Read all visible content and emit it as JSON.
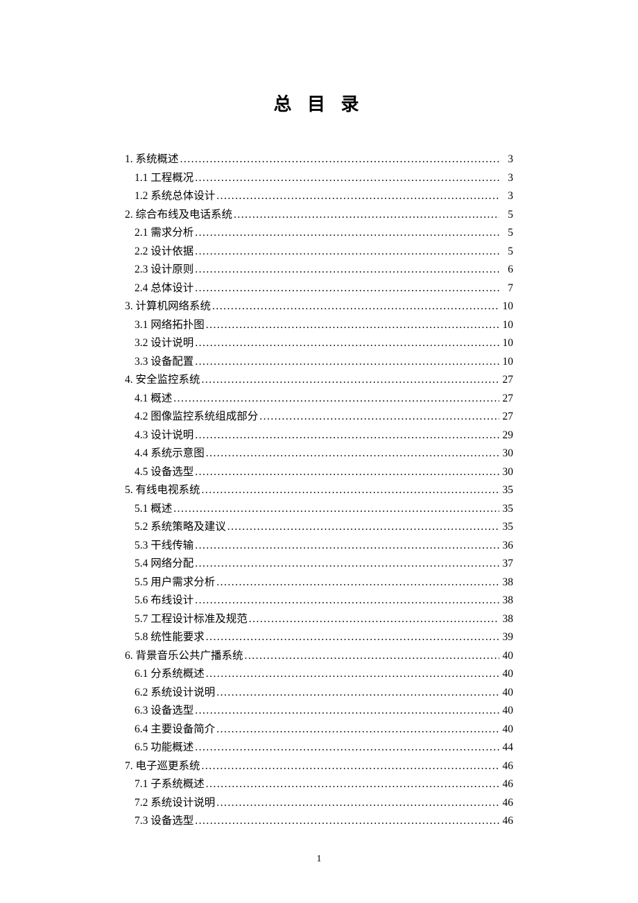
{
  "title": "总 目 录",
  "footer_page": "1",
  "entries": [
    {
      "level": 1,
      "label": "1.  系统概述",
      "page": "3"
    },
    {
      "level": 2,
      "label": "1.1 工程概况",
      "page": "3"
    },
    {
      "level": 2,
      "label": "1.2 系统总体设计",
      "page": "3"
    },
    {
      "level": 1,
      "label": "2.  综合布线及电话系统",
      "page": "5"
    },
    {
      "level": 2,
      "label": "2.1 需求分析",
      "page": "5"
    },
    {
      "level": 2,
      "label": "2.2 设计依据",
      "page": "5"
    },
    {
      "level": 2,
      "label": "2.3 设计原则",
      "page": "6"
    },
    {
      "level": 2,
      "label": "2.4 总体设计",
      "page": "7"
    },
    {
      "level": 1,
      "label": "3.  计算机网络系统",
      "page": "10"
    },
    {
      "level": 2,
      "label": "3.1 网络拓扑图",
      "page": "10"
    },
    {
      "level": 2,
      "label": "3.2 设计说明",
      "page": "10"
    },
    {
      "level": 2,
      "label": "3.3 设备配置",
      "page": "10"
    },
    {
      "level": 1,
      "label": "4. 安全监控系统",
      "page": "27"
    },
    {
      "level": 2,
      "label": "4.1 概述",
      "page": "27"
    },
    {
      "level": 2,
      "label": "4.2  图像监控系统组成部分",
      "page": "27"
    },
    {
      "level": 2,
      "label": "4.3  设计说明",
      "page": "29"
    },
    {
      "level": 2,
      "label": "4.4 系统示意图",
      "page": "30"
    },
    {
      "level": 2,
      "label": "4.5 设备选型",
      "page": "30"
    },
    {
      "level": 1,
      "label": "5.  有线电视系统",
      "page": "35"
    },
    {
      "level": 2,
      "label": "5.1  概述",
      "page": "35"
    },
    {
      "level": 2,
      "label": "5.2  系统策略及建议",
      "page": "35"
    },
    {
      "level": 2,
      "label": "5.3  干线传输",
      "page": "36"
    },
    {
      "level": 2,
      "label": "5.4  网络分配",
      "page": "37"
    },
    {
      "level": 2,
      "label": "5.5  用户需求分析",
      "page": "38"
    },
    {
      "level": 2,
      "label": "5.6  布线设计",
      "page": "38"
    },
    {
      "level": 2,
      "label": "5.7  工程设计标准及规范",
      "page": "38"
    },
    {
      "level": 2,
      "label": "5.8  统性能要求",
      "page": "39"
    },
    {
      "level": 1,
      "label": "6. 背景音乐公共广播系统",
      "page": "40"
    },
    {
      "level": 2,
      "label": "6.1  分系统概述",
      "page": "40"
    },
    {
      "level": 2,
      "label": "6.2 系统设计说明",
      "page": "40"
    },
    {
      "level": 2,
      "label": "6.3  设备选型",
      "page": "40"
    },
    {
      "level": 2,
      "label": "6.4 主要设备简介",
      "page": "40"
    },
    {
      "level": 2,
      "label": "6.5 功能概述",
      "page": "44"
    },
    {
      "level": 1,
      "label": "7.  电子巡更系统",
      "page": "46"
    },
    {
      "level": 2,
      "label": "7.1  子系统概述",
      "page": "46"
    },
    {
      "level": 2,
      "label": "7.2  系统设计说明",
      "page": "46"
    },
    {
      "level": 2,
      "label": "7.3  设备选型",
      "page": "46"
    }
  ]
}
